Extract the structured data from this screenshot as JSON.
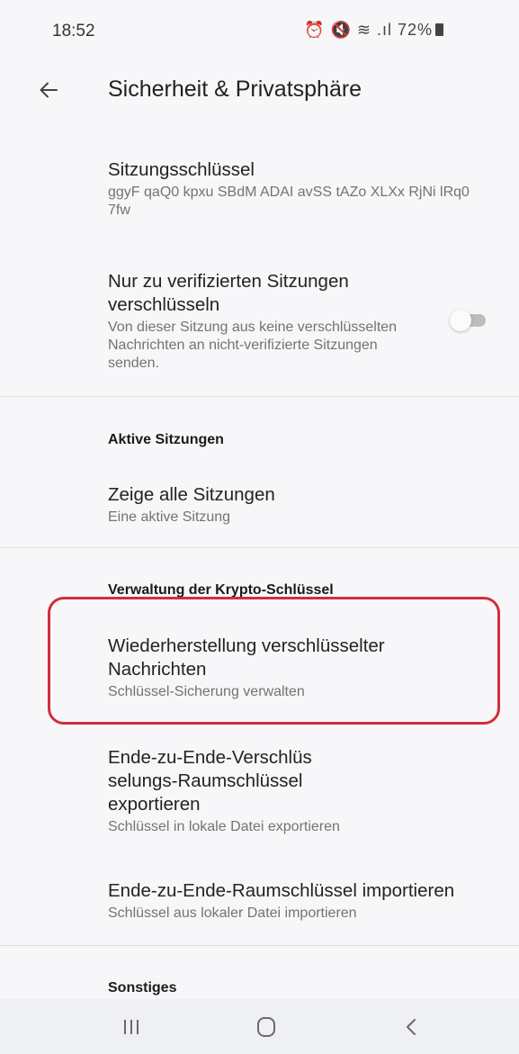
{
  "status_bar": {
    "time": "18:52",
    "icons": [
      "alarm-icon",
      "mute-icon",
      "wifi-icon",
      "signal-icon",
      "battery-icon"
    ],
    "battery": "72%"
  },
  "app_bar": {
    "title": "Sicherheit & Privatsphäre"
  },
  "settings": {
    "session_key": {
      "title": "Sitzungsschlüssel",
      "value": "ggyF qaQ0 kpxu SBdM ADAI avSS tAZo XLXx RjNi lRq0 7fw"
    },
    "encrypt_verified_only": {
      "title": "Nur zu verifizierten Sitzungen verschlüsseln",
      "description": "Von dieser Sitzung aus keine verschlüsselten Nachrichten an nicht-verifizierte Sitzungen senden.",
      "enabled": false
    }
  },
  "sections": {
    "active_sessions": {
      "header": "Aktive Sitzungen",
      "show_all_title": "Zeige alle Sitzungen",
      "show_all_sub": "Eine aktive Sitzung"
    },
    "crypto_keys": {
      "header": "Verwaltung der Krypto-Schlüssel",
      "recovery_title": "Wiederherstellung verschlüsselter Nachrichten",
      "recovery_sub": "Schlüssel-Sicherung verwalten",
      "export_title": "Ende-zu-Ende-Verschlüs selungs-Raumschlüssel exportieren",
      "export_sub": "Schlüssel in lokale Datei exportieren",
      "import_title": "Ende-zu-Ende-Raumschlüssel importieren",
      "import_sub": "Schlüssel aus lokaler Datei importieren"
    },
    "other": {
      "header": "Sonstiges"
    }
  },
  "colors": {
    "background": "#f7f7f9",
    "highlight": "#d22e3c",
    "nav_bar": "#eef0f3"
  },
  "nav_bar": {
    "buttons": [
      "recent-apps-icon",
      "home-icon",
      "back-icon"
    ]
  }
}
